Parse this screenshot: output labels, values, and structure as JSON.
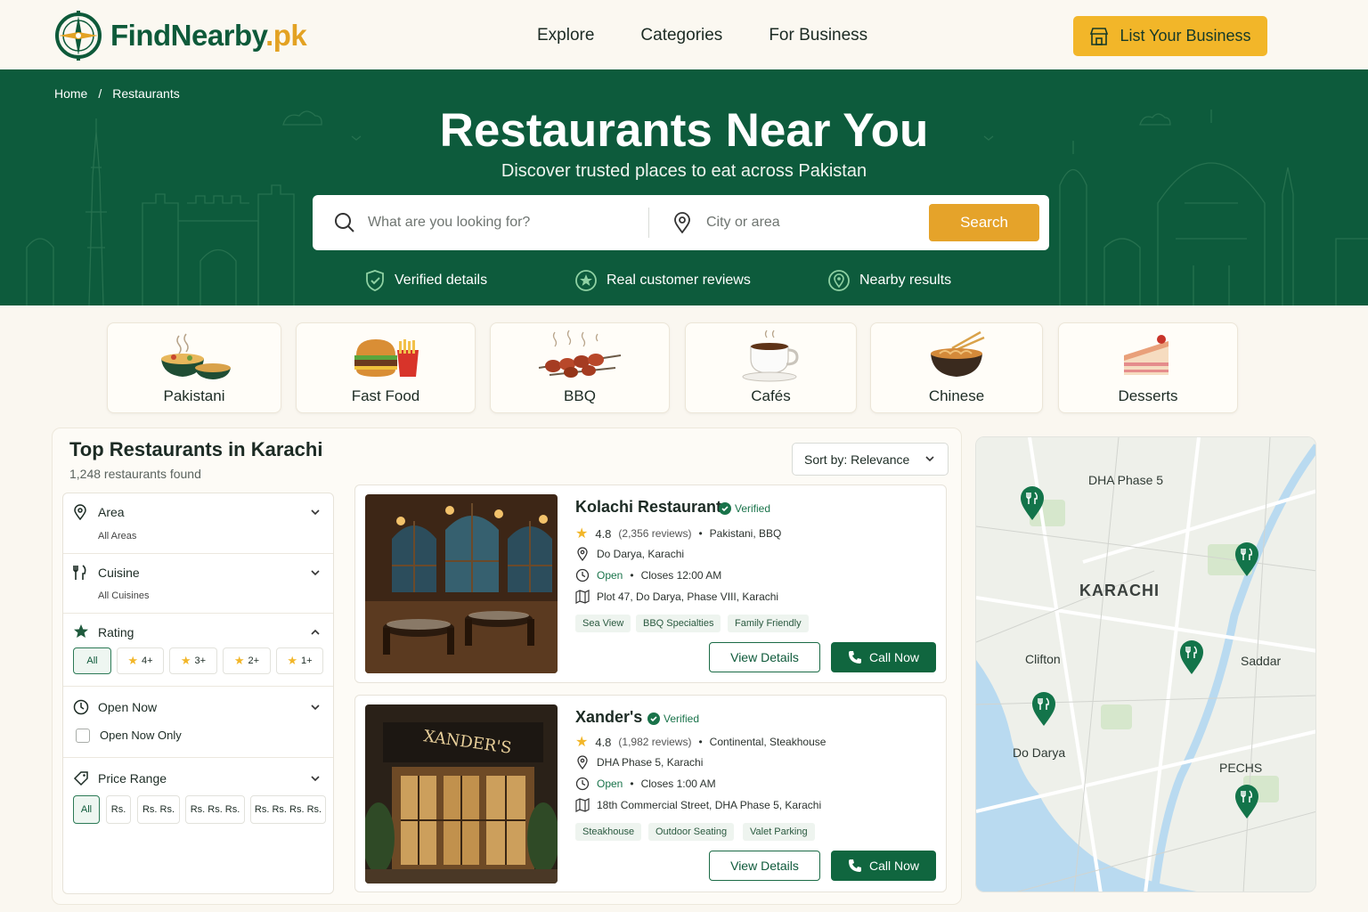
{
  "brand": {
    "name": "FindNearby",
    "tld": ".pk"
  },
  "nav": {
    "explore": "Explore",
    "categories": "Categories",
    "for_business": "For Business"
  },
  "cta": {
    "list_business": "List Your Business"
  },
  "breadcrumb": {
    "home": "Home",
    "separator": "/",
    "current": "Restaurants"
  },
  "hero": {
    "title": "Restaurants Near You",
    "subtitle": "Discover trusted places to eat across Pakistan"
  },
  "search": {
    "what_placeholder": "What are you looking for?",
    "where_placeholder": "City or area",
    "button": "Search"
  },
  "trust": [
    {
      "label": "Verified details",
      "icon": "shield-check-icon"
    },
    {
      "label": "Real customer reviews",
      "icon": "star-badge-icon"
    },
    {
      "label": "Nearby results",
      "icon": "location-badge-icon"
    }
  ],
  "categories": [
    {
      "label": "Pakistani",
      "icon": "biryani-bowl-icon"
    },
    {
      "label": "Fast Food",
      "icon": "burger-fries-icon"
    },
    {
      "label": "BBQ",
      "icon": "kebab-skewer-icon"
    },
    {
      "label": "Cafés",
      "icon": "coffee-cup-icon"
    },
    {
      "label": "Chinese",
      "icon": "noodle-bowl-icon"
    },
    {
      "label": "Desserts",
      "icon": "cake-slice-icon"
    }
  ],
  "listing": {
    "title": "Top Restaurants in Karachi",
    "count": "1,248 restaurants found",
    "sort": "Sort by: Relevance"
  },
  "filters": {
    "area": {
      "title": "Area",
      "value": "All Areas"
    },
    "cuisine": {
      "title": "Cuisine",
      "value": "All Cuisines"
    },
    "rating": {
      "title": "Rating",
      "options": [
        "All",
        "4+",
        "3+",
        "2+",
        "1+"
      ]
    },
    "open_now": {
      "title": "Open Now",
      "option": "Open Now Only"
    },
    "price": {
      "title": "Price Range",
      "options": [
        "All",
        "Rs.",
        "Rs. Rs.",
        "Rs. Rs. Rs.",
        "Rs. Rs. Rs. Rs."
      ]
    }
  },
  "restaurants": [
    {
      "name": "Kolachi Restaurant",
      "verified": "Verified",
      "rating": "4.8",
      "reviews": "(2,356 reviews)",
      "cuisine": "Pakistani, BBQ",
      "area": "Do Darya, Karachi",
      "status": "Open",
      "closes": "Closes 12:00 AM",
      "address": "Plot 47, Do Darya, Phase VIII, Karachi",
      "tags": [
        "Sea View",
        "BBQ Specialties",
        "Family Friendly"
      ],
      "view": "View Details",
      "call": "Call Now"
    },
    {
      "name": "Xander's",
      "verified": "Verified",
      "rating": "4.8",
      "reviews": "(1,982 reviews)",
      "cuisine": "Continental, Steakhouse",
      "area": "DHA Phase 5, Karachi",
      "status": "Open",
      "closes": "Closes 1:00 AM",
      "address": "18th Commercial Street, DHA Phase 5, Karachi",
      "tags": [
        "Steakhouse",
        "Outdoor Seating",
        "Valet Parking"
      ],
      "sign": "XANDER'S",
      "view": "View Details",
      "call": "Call Now"
    }
  ],
  "map": {
    "city": "KARACHI",
    "areas": [
      "DHA Phase 5",
      "Clifton",
      "Saddar",
      "Do Darya",
      "PECHS"
    ]
  },
  "colors": {
    "brand_green": "#0d5b3c",
    "accent_gold": "#f2b629",
    "search_orange": "#e5a32a"
  }
}
